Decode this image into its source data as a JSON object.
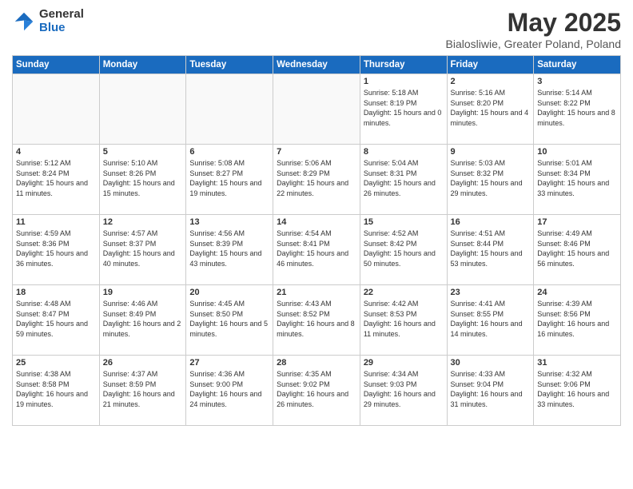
{
  "logo": {
    "general": "General",
    "blue": "Blue"
  },
  "title": "May 2025",
  "subtitle": "Bialosliwie, Greater Poland, Poland",
  "headers": [
    "Sunday",
    "Monday",
    "Tuesday",
    "Wednesday",
    "Thursday",
    "Friday",
    "Saturday"
  ],
  "weeks": [
    [
      {
        "day": "",
        "info": ""
      },
      {
        "day": "",
        "info": ""
      },
      {
        "day": "",
        "info": ""
      },
      {
        "day": "",
        "info": ""
      },
      {
        "day": "1",
        "info": "Sunrise: 5:18 AM\nSunset: 8:19 PM\nDaylight: 15 hours\nand 0 minutes."
      },
      {
        "day": "2",
        "info": "Sunrise: 5:16 AM\nSunset: 8:20 PM\nDaylight: 15 hours\nand 4 minutes."
      },
      {
        "day": "3",
        "info": "Sunrise: 5:14 AM\nSunset: 8:22 PM\nDaylight: 15 hours\nand 8 minutes."
      }
    ],
    [
      {
        "day": "4",
        "info": "Sunrise: 5:12 AM\nSunset: 8:24 PM\nDaylight: 15 hours\nand 11 minutes."
      },
      {
        "day": "5",
        "info": "Sunrise: 5:10 AM\nSunset: 8:26 PM\nDaylight: 15 hours\nand 15 minutes."
      },
      {
        "day": "6",
        "info": "Sunrise: 5:08 AM\nSunset: 8:27 PM\nDaylight: 15 hours\nand 19 minutes."
      },
      {
        "day": "7",
        "info": "Sunrise: 5:06 AM\nSunset: 8:29 PM\nDaylight: 15 hours\nand 22 minutes."
      },
      {
        "day": "8",
        "info": "Sunrise: 5:04 AM\nSunset: 8:31 PM\nDaylight: 15 hours\nand 26 minutes."
      },
      {
        "day": "9",
        "info": "Sunrise: 5:03 AM\nSunset: 8:32 PM\nDaylight: 15 hours\nand 29 minutes."
      },
      {
        "day": "10",
        "info": "Sunrise: 5:01 AM\nSunset: 8:34 PM\nDaylight: 15 hours\nand 33 minutes."
      }
    ],
    [
      {
        "day": "11",
        "info": "Sunrise: 4:59 AM\nSunset: 8:36 PM\nDaylight: 15 hours\nand 36 minutes."
      },
      {
        "day": "12",
        "info": "Sunrise: 4:57 AM\nSunset: 8:37 PM\nDaylight: 15 hours\nand 40 minutes."
      },
      {
        "day": "13",
        "info": "Sunrise: 4:56 AM\nSunset: 8:39 PM\nDaylight: 15 hours\nand 43 minutes."
      },
      {
        "day": "14",
        "info": "Sunrise: 4:54 AM\nSunset: 8:41 PM\nDaylight: 15 hours\nand 46 minutes."
      },
      {
        "day": "15",
        "info": "Sunrise: 4:52 AM\nSunset: 8:42 PM\nDaylight: 15 hours\nand 50 minutes."
      },
      {
        "day": "16",
        "info": "Sunrise: 4:51 AM\nSunset: 8:44 PM\nDaylight: 15 hours\nand 53 minutes."
      },
      {
        "day": "17",
        "info": "Sunrise: 4:49 AM\nSunset: 8:46 PM\nDaylight: 15 hours\nand 56 minutes."
      }
    ],
    [
      {
        "day": "18",
        "info": "Sunrise: 4:48 AM\nSunset: 8:47 PM\nDaylight: 15 hours\nand 59 minutes."
      },
      {
        "day": "19",
        "info": "Sunrise: 4:46 AM\nSunset: 8:49 PM\nDaylight: 16 hours\nand 2 minutes."
      },
      {
        "day": "20",
        "info": "Sunrise: 4:45 AM\nSunset: 8:50 PM\nDaylight: 16 hours\nand 5 minutes."
      },
      {
        "day": "21",
        "info": "Sunrise: 4:43 AM\nSunset: 8:52 PM\nDaylight: 16 hours\nand 8 minutes."
      },
      {
        "day": "22",
        "info": "Sunrise: 4:42 AM\nSunset: 8:53 PM\nDaylight: 16 hours\nand 11 minutes."
      },
      {
        "day": "23",
        "info": "Sunrise: 4:41 AM\nSunset: 8:55 PM\nDaylight: 16 hours\nand 14 minutes."
      },
      {
        "day": "24",
        "info": "Sunrise: 4:39 AM\nSunset: 8:56 PM\nDaylight: 16 hours\nand 16 minutes."
      }
    ],
    [
      {
        "day": "25",
        "info": "Sunrise: 4:38 AM\nSunset: 8:58 PM\nDaylight: 16 hours\nand 19 minutes."
      },
      {
        "day": "26",
        "info": "Sunrise: 4:37 AM\nSunset: 8:59 PM\nDaylight: 16 hours\nand 21 minutes."
      },
      {
        "day": "27",
        "info": "Sunrise: 4:36 AM\nSunset: 9:00 PM\nDaylight: 16 hours\nand 24 minutes."
      },
      {
        "day": "28",
        "info": "Sunrise: 4:35 AM\nSunset: 9:02 PM\nDaylight: 16 hours\nand 26 minutes."
      },
      {
        "day": "29",
        "info": "Sunrise: 4:34 AM\nSunset: 9:03 PM\nDaylight: 16 hours\nand 29 minutes."
      },
      {
        "day": "30",
        "info": "Sunrise: 4:33 AM\nSunset: 9:04 PM\nDaylight: 16 hours\nand 31 minutes."
      },
      {
        "day": "31",
        "info": "Sunrise: 4:32 AM\nSunset: 9:06 PM\nDaylight: 16 hours\nand 33 minutes."
      }
    ]
  ]
}
